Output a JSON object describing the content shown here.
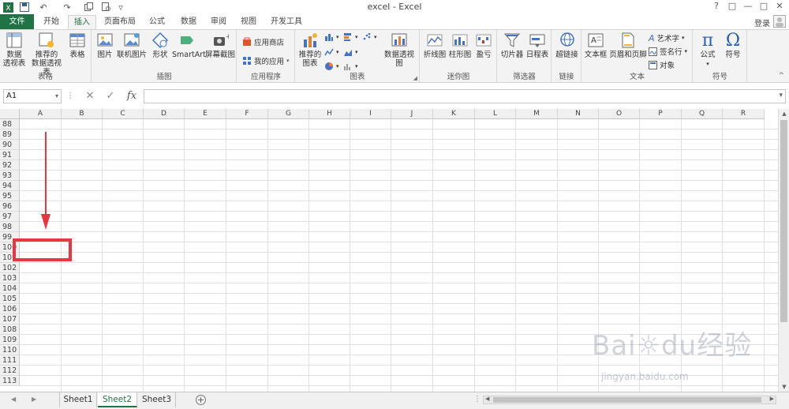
{
  "window": {
    "title": "excel - Excel",
    "help": "?",
    "controls": [
      "□",
      "—",
      "□",
      "✕"
    ]
  },
  "quick_access": [
    "↶",
    "↷",
    "▿"
  ],
  "tabs": [
    {
      "label": "文件"
    },
    {
      "label": "开始"
    },
    {
      "label": "插入"
    },
    {
      "label": "页面布局"
    },
    {
      "label": "公式"
    },
    {
      "label": "数据"
    },
    {
      "label": "审阅"
    },
    {
      "label": "视图"
    },
    {
      "label": "开发工具"
    }
  ],
  "active_tab": "插入",
  "login": "登录",
  "ribbon": {
    "tables": {
      "label": "表格",
      "pivot1": "数据",
      "pivot2": "透视表",
      "rec1": "推荐的",
      "rec2": "数据透视表",
      "table": "表格"
    },
    "illustrations": {
      "label": "插图",
      "picture": "图片",
      "online_picture": "联机图片",
      "shapes": "形状",
      "smartart": "SmartArt",
      "screenshot": "屏幕截图"
    },
    "apps": {
      "label": "应用程序",
      "store": "应用商店",
      "my_apps": "我的应用"
    },
    "charts": {
      "label": "图表",
      "recommended1": "推荐的",
      "recommended2": "图表",
      "pivot_chart": "数据透视图"
    },
    "sparklines": {
      "label": "迷你图",
      "line": "折线图",
      "column": "柱形图",
      "winloss": "盈亏"
    },
    "filters": {
      "label": "筛选器",
      "slicer": "切片器",
      "timeline": "日程表"
    },
    "links": {
      "label": "链接",
      "hyperlink": "超链接"
    },
    "text": {
      "label": "文本",
      "textbox": "文本框",
      "header_footer": "页眉和页脚",
      "wordart": "艺术字",
      "signature": "签名行",
      "object": "对象"
    },
    "symbols": {
      "label": "符号",
      "equation": "公式",
      "symbol": "符号",
      "pi": "π",
      "omega": "Ω"
    }
  },
  "formula_bar": {
    "name_box": "A1",
    "cancel": "✕",
    "enter": "✓",
    "fx": "fx",
    "value": ""
  },
  "columns": [
    "A",
    "B",
    "C",
    "D",
    "E",
    "F",
    "G",
    "H",
    "I",
    "J",
    "K",
    "L",
    "M",
    "N",
    "O",
    "P",
    "Q",
    "R"
  ],
  "rows": [
    "88",
    "89",
    "90",
    "91",
    "92",
    "93",
    "94",
    "95",
    "96",
    "97",
    "98",
    "99",
    "100",
    "101",
    "102",
    "103",
    "104",
    "105",
    "106",
    "107",
    "108",
    "109",
    "110",
    "111",
    "112",
    "113"
  ],
  "sheets": [
    "Sheet1",
    "Sheet2",
    "Sheet3"
  ],
  "active_sheet": "Sheet2",
  "add_sheet": "+",
  "watermark": {
    "main": "Bai☼du经验",
    "sub": "jingyan.baidu.com"
  },
  "colors": {
    "excel_green": "#217346",
    "annotation_red": "#e8373f"
  }
}
